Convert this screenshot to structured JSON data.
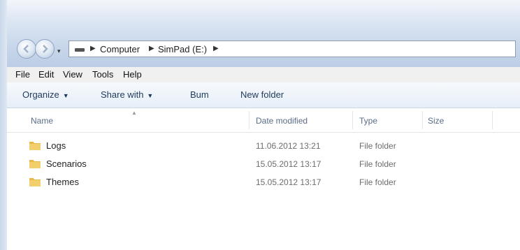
{
  "address_bar": {
    "crumbs": [
      "Computer",
      "SimPad (E:)"
    ]
  },
  "menu": [
    "File",
    "Edit",
    "View",
    "Tools",
    "Help"
  ],
  "toolbar": {
    "organize": "Organize",
    "share_with": "Share with",
    "burn": "Bum",
    "new_folder": "New folder"
  },
  "columns": {
    "name": "Name",
    "date_modified": "Date modified",
    "type": "Type",
    "size": "Size"
  },
  "files": [
    {
      "name": "Logs",
      "date_modified": "11.06.2012 13:21",
      "type": "File folder"
    },
    {
      "name": "Scenarios",
      "date_modified": "15.05.2012 13:17",
      "type": "File folder"
    },
    {
      "name": "Themes",
      "date_modified": "15.05.2012 13:17",
      "type": "File folder"
    }
  ],
  "colors": {
    "titlebar": "#c7d6ea",
    "toolbar_text": "#1e395b",
    "folder": "#e8b84a"
  }
}
